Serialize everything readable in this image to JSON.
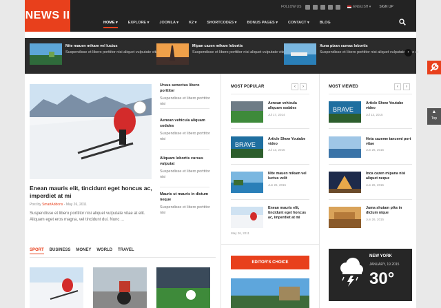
{
  "header": {
    "logo": "NEWS II",
    "follow_label": "FOLLOW US",
    "language": "ENGLISH",
    "signup": "SIGN UP",
    "nav": [
      "HOME",
      "EXPLORE",
      "JOOMLA",
      "K2",
      "SHORTCODES",
      "BONUS PAGES",
      "CONTACT",
      "BLOG"
    ]
  },
  "ticker": [
    {
      "title": "Nite mauen mikam vel luctus",
      "desc": "Suspendisse et libero porttitor nisi aliquet vulputate vitae at"
    },
    {
      "title": "Mipan cazen mikam lobortis",
      "desc": "Suspendisse et libero porttitor nisi aliquet vulputate vitae at"
    },
    {
      "title": "Xuna pizan sumas lobortis",
      "desc": "Suspendisse et libero porttitor nisi aliquet vulputate vitae at"
    }
  ],
  "featured": {
    "title": "Enean mauris elit, tincidunt eget honcus ac, imperdiet at mi",
    "meta_prefix": "Post by",
    "author": "SmartAddons",
    "date": "May 26, 2011",
    "desc": "Suspendisse et libero porttitor nisi aliquet vulputate vitae at elit. Aliquam eget eros magna, vel tincidunt dui. Nunc ..."
  },
  "side_list": [
    {
      "title": "Ursus senectus libero porttitor",
      "desc": "Suspendisse et libero porttitor nisi"
    },
    {
      "title": "Aenean vehicula aliquam sodales",
      "desc": "Suspendisse et libero porttitor nisi"
    },
    {
      "title": "Aliquam lobortis cursus vulputat",
      "desc": "Suspendisse et libero porttitor nisi"
    },
    {
      "title": "Mauris ut mauris in dictum neque",
      "desc": "Suspendisse et libero porttitor nisi"
    }
  ],
  "tabs": [
    "SPORT",
    "BUSINESS",
    "MONEY",
    "WORLD",
    "TRAVEL"
  ],
  "most_popular": {
    "heading": "MOST POPULAR",
    "items": [
      {
        "title": "Aenean vehicula aliquam sodales",
        "date": "Jul 17, 2014"
      },
      {
        "title": "Article Show Youtube video",
        "date": "Jul 13, 2015"
      },
      {
        "title": "Nite mauen mikam vel luctus velit",
        "date": "Jun 26, 2015"
      },
      {
        "title": "Enean mauris elit, tincidunt eget honcus ac, imperdiet at mi",
        "date": "May 26, 2011"
      }
    ]
  },
  "most_viewed": {
    "heading": "MOST VIEWED",
    "items": [
      {
        "title": "Article Show Youtube video",
        "date": "Jul 13, 2015"
      },
      {
        "title": "Heta cazeme tancemi port vitae",
        "date": "Jun 26, 2015"
      },
      {
        "title": "Inca cazen mipana nisi aliquet neque",
        "date": "Jun 26, 2015"
      },
      {
        "title": "Juma shutam piks in dictum nique",
        "date": "Jun 26, 2015"
      }
    ]
  },
  "editors_choice": "EDITOR'S CHOICE",
  "weather": {
    "city": "NEW YORK",
    "date": "JANUARY, 19 2015",
    "temp": "30°"
  },
  "back_to_top": "Top",
  "colors": {
    "accent": "#e8401c",
    "dark": "#232323"
  }
}
